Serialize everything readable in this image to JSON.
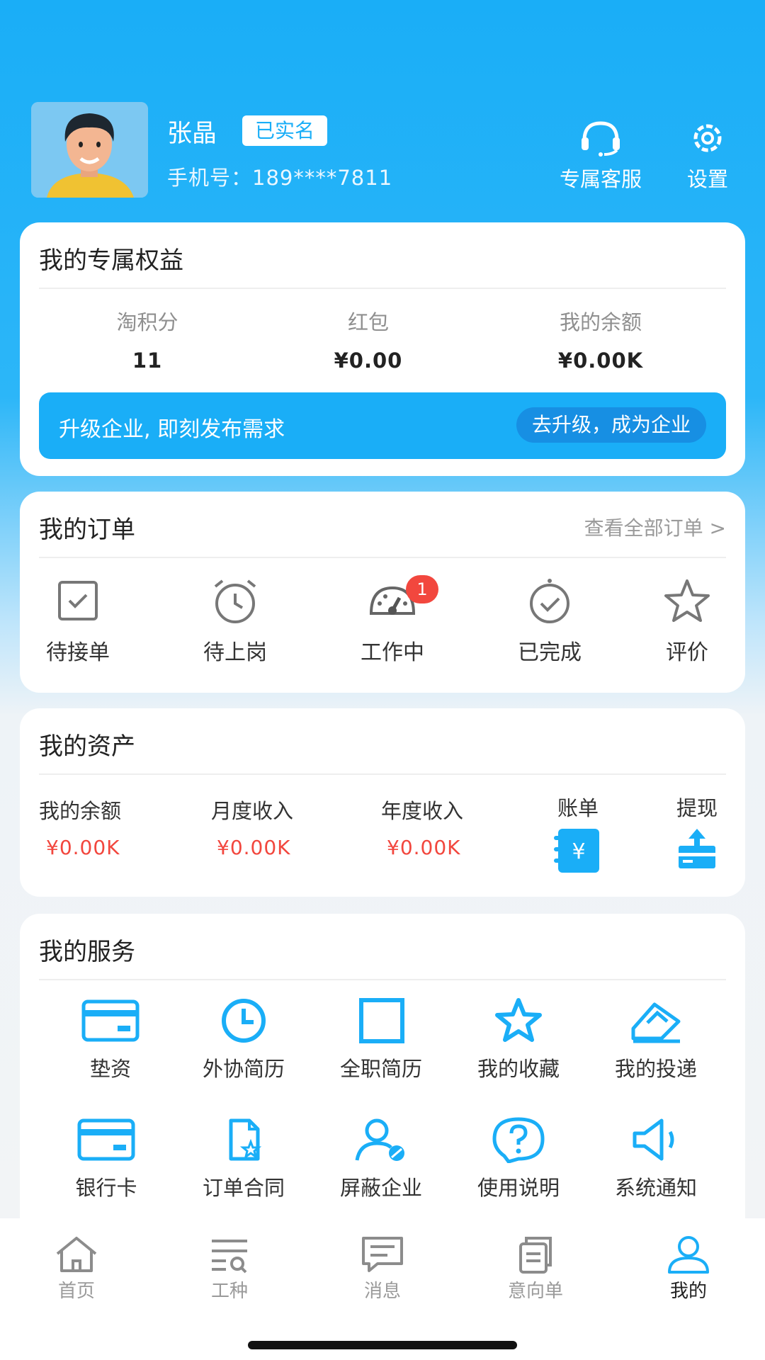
{
  "user": {
    "name": "张晶",
    "verified_label": "已实名",
    "phone": "手机号：189****7811"
  },
  "header": {
    "service_label": "专属客服",
    "settings_label": "设置"
  },
  "benefits": {
    "title": "我的专属权益",
    "stats": [
      {
        "label": "淘积分",
        "value": "11"
      },
      {
        "label": "红包",
        "value": "¥0.00"
      },
      {
        "label": "我的余额",
        "value": "¥0.00K"
      }
    ],
    "upgrade_text": "升级企业, 即刻发布需求",
    "upgrade_button": "去升级，成为企业"
  },
  "orders": {
    "title": "我的订单",
    "view_all": "查看全部订单 >",
    "items": [
      {
        "label": "待接单",
        "icon": "check-box-icon"
      },
      {
        "label": "待上岗",
        "icon": "alarm-clock-icon"
      },
      {
        "label": "工作中",
        "icon": "speedometer-icon",
        "badge": "1"
      },
      {
        "label": "已完成",
        "icon": "done-clock-icon"
      },
      {
        "label": "评价",
        "icon": "star-icon"
      }
    ]
  },
  "assets": {
    "title": "我的资产",
    "items": [
      {
        "label": "我的余额",
        "value": "¥0.00K"
      },
      {
        "label": "月度收入",
        "value": "¥0.00K"
      },
      {
        "label": "年度收入",
        "value": "¥0.00K"
      }
    ],
    "bill_label": "账单",
    "withdraw_label": "提现"
  },
  "services": {
    "title": "我的服务",
    "items": [
      {
        "label": "垫资",
        "icon": "card-icon"
      },
      {
        "label": "外协简历",
        "icon": "clock-icon"
      },
      {
        "label": "全职简历",
        "icon": "square-icon"
      },
      {
        "label": "我的收藏",
        "icon": "star-icon"
      },
      {
        "label": "我的投递",
        "icon": "delivery-icon"
      },
      {
        "label": "银行卡",
        "icon": "bank-card-icon"
      },
      {
        "label": "订单合同",
        "icon": "contract-icon"
      },
      {
        "label": "屏蔽企业",
        "icon": "block-user-icon"
      },
      {
        "label": "使用说明",
        "icon": "help-icon"
      },
      {
        "label": "系统通知",
        "icon": "megaphone-icon"
      }
    ]
  },
  "tabs": [
    {
      "label": "首页",
      "icon": "home-icon"
    },
    {
      "label": "工种",
      "icon": "list-search-icon"
    },
    {
      "label": "消息",
      "icon": "message-icon"
    },
    {
      "label": "意向单",
      "icon": "documents-icon"
    },
    {
      "label": "我的",
      "icon": "profile-icon",
      "active": true
    }
  ],
  "colors": {
    "primary": "#1aaef7",
    "accent_red": "#f2473e",
    "text_dark": "#222222",
    "text_gray": "#9a9a9a"
  }
}
